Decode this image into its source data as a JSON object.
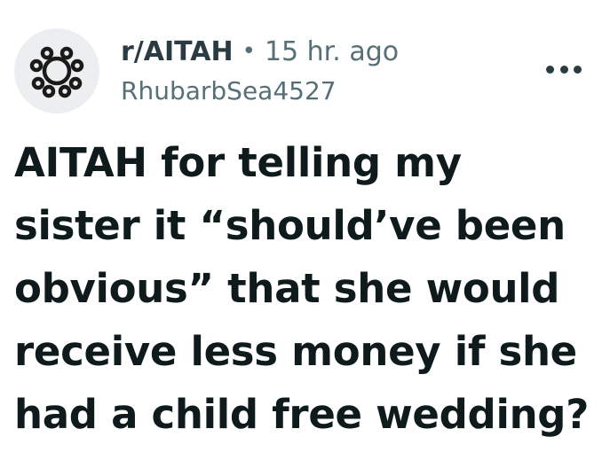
{
  "post": {
    "subreddit": "r/AITAH",
    "separator": "•",
    "time_ago": "15 hr. ago",
    "username": "RhubarbSea4527",
    "avatar_icon": "community-snoo-icon",
    "more_icon": "more-options-icon",
    "title_lines": [
      "AITAH for telling my",
      "sister it “should’ve been",
      "obvious” that she would",
      "receive less money if she",
      "had a child free wedding?"
    ]
  },
  "colors": {
    "background": "#ffffff",
    "avatar_bg": "#eceeef",
    "meta_text": "#576f76",
    "title_text": "#0f1a1c"
  }
}
